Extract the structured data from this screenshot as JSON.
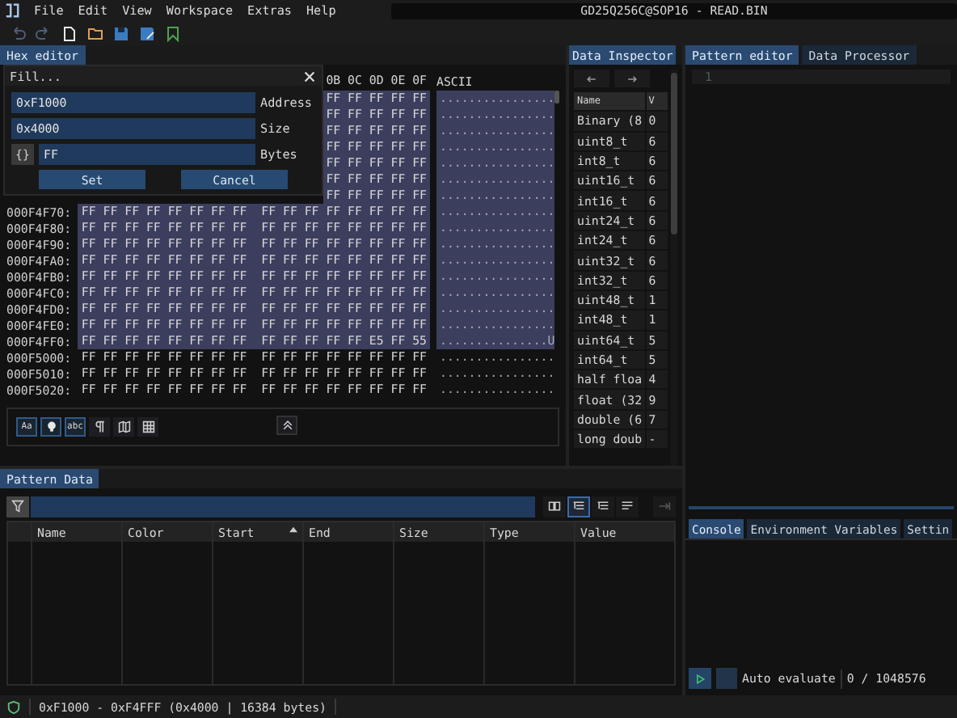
{
  "menu": [
    "File",
    "Edit",
    "View",
    "Workspace",
    "Extras",
    "Help"
  ],
  "window": {
    "title": "GD25Q256C@SOP16 - READ.BIN"
  },
  "toolbar": [
    {
      "kind": "undo",
      "disabled": true
    },
    {
      "kind": "redo",
      "disabled": true
    },
    {
      "kind": "new-file",
      "disabled": false
    },
    {
      "kind": "open-folder",
      "disabled": false
    },
    {
      "kind": "save",
      "disabled": false
    },
    {
      "kind": "save-as",
      "disabled": false
    },
    {
      "kind": "bookmark",
      "disabled": false
    }
  ],
  "hex_editor": {
    "tab": {
      "label": "Hex editor",
      "selected": true
    },
    "columns_visible": "0B 0C 0D 0E 0F",
    "ascii_header": "ASCII",
    "rows": [
      {
        "bytes": "FF FF FF FF FF",
        "ascii": "................",
        "selected": true
      },
      {
        "bytes": "FF FF FF FF FF",
        "ascii": "................",
        "selected": true
      },
      {
        "bytes": "FF FF FF FF FF",
        "ascii": "................",
        "selected": true
      },
      {
        "bytes": "FF FF FF FF FF",
        "ascii": "................",
        "selected": true
      },
      {
        "bytes": "FF FF FF FF FF",
        "ascii": "................",
        "selected": true
      },
      {
        "bytes": "FF FF FF FF FF",
        "ascii": "................",
        "selected": true
      },
      {
        "bytes": "FF FF FF FF FF",
        "ascii": "................",
        "selected": true
      },
      {
        "address": "000F4F70:",
        "bytes": "FF FF FF FF FF FF FF FF  FF FF FF FF FF FF FF FF",
        "ascii": "................",
        "selected": true
      },
      {
        "address": "000F4F80:",
        "bytes": "FF FF FF FF FF FF FF FF  FF FF FF FF FF FF FF FF",
        "ascii": "................",
        "selected": true
      },
      {
        "address": "000F4F90:",
        "bytes": "FF FF FF FF FF FF FF FF  FF FF FF FF FF FF FF FF",
        "ascii": "................",
        "selected": true
      },
      {
        "address": "000F4FA0:",
        "bytes": "FF FF FF FF FF FF FF FF  FF FF FF FF FF FF FF FF",
        "ascii": "................",
        "selected": true
      },
      {
        "address": "000F4FB0:",
        "bytes": "FF FF FF FF FF FF FF FF  FF FF FF FF FF FF FF FF",
        "ascii": "................",
        "selected": true
      },
      {
        "address": "000F4FC0:",
        "bytes": "FF FF FF FF FF FF FF FF  FF FF FF FF FF FF FF FF",
        "ascii": "................",
        "selected": true
      },
      {
        "address": "000F4FD0:",
        "bytes": "FF FF FF FF FF FF FF FF  FF FF FF FF FF FF FF FF",
        "ascii": "................",
        "selected": true
      },
      {
        "address": "000F4FE0:",
        "bytes": "FF FF FF FF FF FF FF FF  FF FF FF FF FF FF FF FF",
        "ascii": "................",
        "selected": true
      },
      {
        "address": "000F4FF0:",
        "bytes": "FF FF FF FF FF FF FF FF  FF FF FF FF FF E5 FF 55",
        "ascii": "...............U",
        "selected": true
      },
      {
        "address": "000F5000:",
        "bytes": "FF FF FF FF FF FF FF FF  FF FF FF FF FF FF FF FF",
        "ascii": "................",
        "selected": false
      },
      {
        "address": "000F5010:",
        "bytes": "FF FF FF FF FF FF FF FF  FF FF FF FF FF FF FF FF",
        "ascii": "................",
        "selected": false
      },
      {
        "address": "000F5020:",
        "bytes": "FF FF FF FF FF FF FF FF  FF FF FF FF FF FF FF FF",
        "ascii": "................",
        "selected": false
      }
    ],
    "tools": [
      {
        "kind": "text",
        "label": "Aa",
        "on": true
      },
      {
        "kind": "bulb",
        "on": true
      },
      {
        "kind": "text",
        "label": "abc",
        "on": true
      },
      {
        "kind": "pilcrow",
        "on": false
      },
      {
        "kind": "map",
        "on": false
      },
      {
        "kind": "grid",
        "on": false
      }
    ]
  },
  "fill_dialog": {
    "title": "Fill...",
    "fields": [
      {
        "value": "0xF1000",
        "label": "Address"
      },
      {
        "value": "0x4000",
        "label": "Size"
      },
      {
        "value": "FF",
        "label": "Bytes",
        "prefix_button": "{}"
      }
    ],
    "buttons": [
      "Set",
      "Cancel"
    ]
  },
  "data_inspector": {
    "tab": {
      "label": "Data Inspector",
      "selected": true
    },
    "columns": [
      "Name",
      "V"
    ],
    "rows": [
      [
        "Binary (8",
        "0"
      ],
      [
        "uint8_t",
        "6"
      ],
      [
        "int8_t",
        "6"
      ],
      [
        "uint16_t",
        "6"
      ],
      [
        "int16_t",
        "6"
      ],
      [
        "uint24_t",
        "6"
      ],
      [
        "int24_t",
        "6"
      ],
      [
        "uint32_t",
        "6"
      ],
      [
        "int32_t",
        "6"
      ],
      [
        "uint48_t",
        "1"
      ],
      [
        "int48_t",
        "1"
      ],
      [
        "uint64_t",
        "5"
      ],
      [
        "int64_t",
        "5"
      ],
      [
        "half floa",
        "4"
      ],
      [
        "float (32",
        "9"
      ],
      [
        "double (6",
        "7"
      ],
      [
        "long doub",
        "-"
      ]
    ]
  },
  "pattern_editor": {
    "tabs": [
      {
        "label": "Pattern editor",
        "selected": true
      },
      {
        "label": "Data Processor",
        "selected": false
      }
    ],
    "line_numbers": [
      "1"
    ],
    "console_tabs": [
      {
        "label": "Console",
        "selected": true
      },
      {
        "label": "Environment Variables",
        "selected": false
      },
      {
        "label": "Settin",
        "selected": false
      }
    ],
    "auto_evaluate": {
      "label": "Auto evaluate",
      "checked": false
    },
    "counter": "0 / 1048576"
  },
  "pattern_data": {
    "tab": {
      "label": "Pattern Data",
      "selected": true
    },
    "view_modes": [
      {
        "kind": "book",
        "selected": false
      },
      {
        "kind": "tree",
        "selected": true
      },
      {
        "kind": "tree",
        "selected": false
      },
      {
        "kind": "flat",
        "selected": false
      }
    ],
    "columns": [
      {
        "label": "Name",
        "sorted": false
      },
      {
        "label": "Color",
        "sorted": false
      },
      {
        "label": "Start",
        "sorted": true
      },
      {
        "label": "End",
        "sorted": false
      },
      {
        "label": "Size",
        "sorted": false
      },
      {
        "label": "Type",
        "sorted": false
      },
      {
        "label": "Value",
        "sorted": false
      }
    ]
  },
  "status_bar": {
    "selection": "0xF1000 - 0xF4FFF (0x4000 | 16384 bytes)"
  }
}
